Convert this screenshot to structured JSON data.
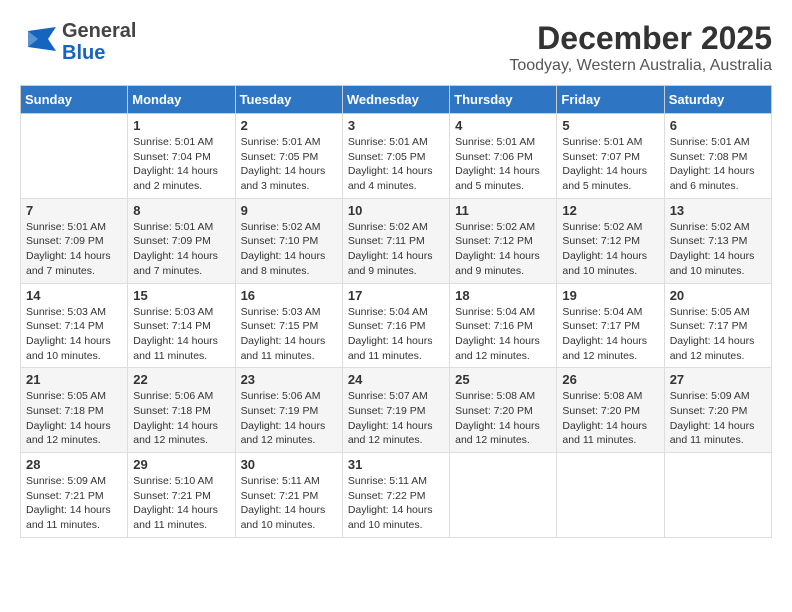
{
  "header": {
    "logo": {
      "general": "General",
      "blue": "Blue"
    },
    "month_title": "December 2025",
    "location": "Toodyay, Western Australia, Australia"
  },
  "days_of_week": [
    "Sunday",
    "Monday",
    "Tuesday",
    "Wednesday",
    "Thursday",
    "Friday",
    "Saturday"
  ],
  "weeks": [
    [
      {
        "day": "",
        "info": ""
      },
      {
        "day": "1",
        "info": "Sunrise: 5:01 AM\nSunset: 7:04 PM\nDaylight: 14 hours\nand 2 minutes."
      },
      {
        "day": "2",
        "info": "Sunrise: 5:01 AM\nSunset: 7:05 PM\nDaylight: 14 hours\nand 3 minutes."
      },
      {
        "day": "3",
        "info": "Sunrise: 5:01 AM\nSunset: 7:05 PM\nDaylight: 14 hours\nand 4 minutes."
      },
      {
        "day": "4",
        "info": "Sunrise: 5:01 AM\nSunset: 7:06 PM\nDaylight: 14 hours\nand 5 minutes."
      },
      {
        "day": "5",
        "info": "Sunrise: 5:01 AM\nSunset: 7:07 PM\nDaylight: 14 hours\nand 5 minutes."
      },
      {
        "day": "6",
        "info": "Sunrise: 5:01 AM\nSunset: 7:08 PM\nDaylight: 14 hours\nand 6 minutes."
      }
    ],
    [
      {
        "day": "7",
        "info": "Sunrise: 5:01 AM\nSunset: 7:09 PM\nDaylight: 14 hours\nand 7 minutes."
      },
      {
        "day": "8",
        "info": "Sunrise: 5:01 AM\nSunset: 7:09 PM\nDaylight: 14 hours\nand 7 minutes."
      },
      {
        "day": "9",
        "info": "Sunrise: 5:02 AM\nSunset: 7:10 PM\nDaylight: 14 hours\nand 8 minutes."
      },
      {
        "day": "10",
        "info": "Sunrise: 5:02 AM\nSunset: 7:11 PM\nDaylight: 14 hours\nand 9 minutes."
      },
      {
        "day": "11",
        "info": "Sunrise: 5:02 AM\nSunset: 7:12 PM\nDaylight: 14 hours\nand 9 minutes."
      },
      {
        "day": "12",
        "info": "Sunrise: 5:02 AM\nSunset: 7:12 PM\nDaylight: 14 hours\nand 10 minutes."
      },
      {
        "day": "13",
        "info": "Sunrise: 5:02 AM\nSunset: 7:13 PM\nDaylight: 14 hours\nand 10 minutes."
      }
    ],
    [
      {
        "day": "14",
        "info": "Sunrise: 5:03 AM\nSunset: 7:14 PM\nDaylight: 14 hours\nand 10 minutes."
      },
      {
        "day": "15",
        "info": "Sunrise: 5:03 AM\nSunset: 7:14 PM\nDaylight: 14 hours\nand 11 minutes."
      },
      {
        "day": "16",
        "info": "Sunrise: 5:03 AM\nSunset: 7:15 PM\nDaylight: 14 hours\nand 11 minutes."
      },
      {
        "day": "17",
        "info": "Sunrise: 5:04 AM\nSunset: 7:16 PM\nDaylight: 14 hours\nand 11 minutes."
      },
      {
        "day": "18",
        "info": "Sunrise: 5:04 AM\nSunset: 7:16 PM\nDaylight: 14 hours\nand 12 minutes."
      },
      {
        "day": "19",
        "info": "Sunrise: 5:04 AM\nSunset: 7:17 PM\nDaylight: 14 hours\nand 12 minutes."
      },
      {
        "day": "20",
        "info": "Sunrise: 5:05 AM\nSunset: 7:17 PM\nDaylight: 14 hours\nand 12 minutes."
      }
    ],
    [
      {
        "day": "21",
        "info": "Sunrise: 5:05 AM\nSunset: 7:18 PM\nDaylight: 14 hours\nand 12 minutes."
      },
      {
        "day": "22",
        "info": "Sunrise: 5:06 AM\nSunset: 7:18 PM\nDaylight: 14 hours\nand 12 minutes."
      },
      {
        "day": "23",
        "info": "Sunrise: 5:06 AM\nSunset: 7:19 PM\nDaylight: 14 hours\nand 12 minutes."
      },
      {
        "day": "24",
        "info": "Sunrise: 5:07 AM\nSunset: 7:19 PM\nDaylight: 14 hours\nand 12 minutes."
      },
      {
        "day": "25",
        "info": "Sunrise: 5:08 AM\nSunset: 7:20 PM\nDaylight: 14 hours\nand 12 minutes."
      },
      {
        "day": "26",
        "info": "Sunrise: 5:08 AM\nSunset: 7:20 PM\nDaylight: 14 hours\nand 11 minutes."
      },
      {
        "day": "27",
        "info": "Sunrise: 5:09 AM\nSunset: 7:20 PM\nDaylight: 14 hours\nand 11 minutes."
      }
    ],
    [
      {
        "day": "28",
        "info": "Sunrise: 5:09 AM\nSunset: 7:21 PM\nDaylight: 14 hours\nand 11 minutes."
      },
      {
        "day": "29",
        "info": "Sunrise: 5:10 AM\nSunset: 7:21 PM\nDaylight: 14 hours\nand 11 minutes."
      },
      {
        "day": "30",
        "info": "Sunrise: 5:11 AM\nSunset: 7:21 PM\nDaylight: 14 hours\nand 10 minutes."
      },
      {
        "day": "31",
        "info": "Sunrise: 5:11 AM\nSunset: 7:22 PM\nDaylight: 14 hours\nand 10 minutes."
      },
      {
        "day": "",
        "info": ""
      },
      {
        "day": "",
        "info": ""
      },
      {
        "day": "",
        "info": ""
      }
    ]
  ]
}
